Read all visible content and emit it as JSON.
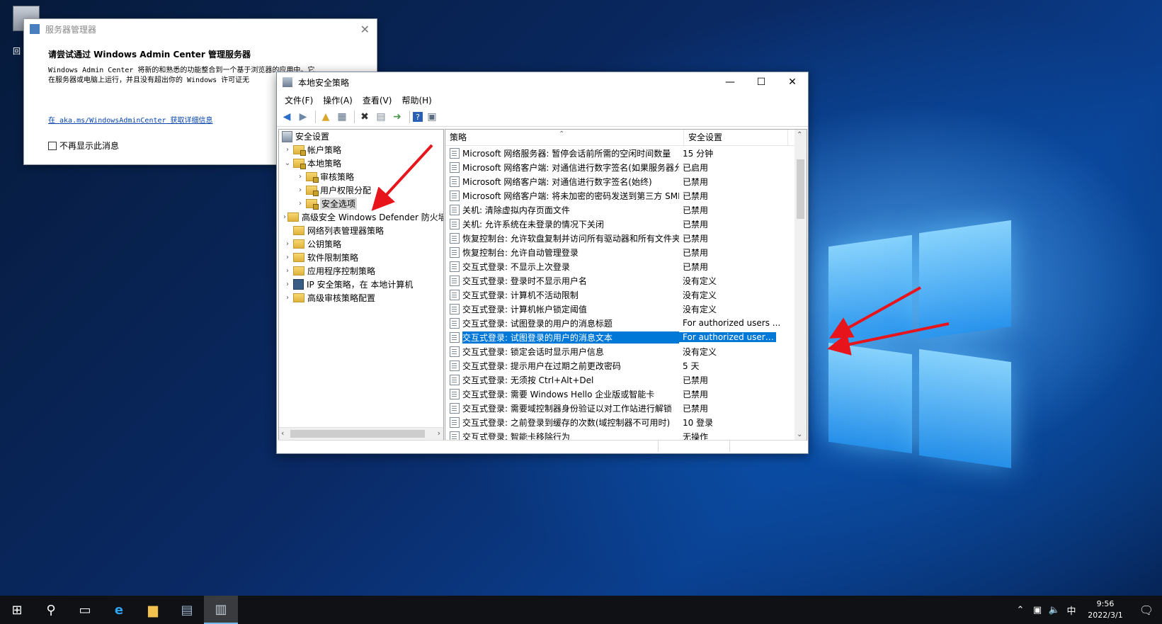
{
  "desktop": {
    "icon_label": "回"
  },
  "server_manager": {
    "title": "服务器管理器",
    "heading": "请尝试通过 Windows Admin Center 管理服务器",
    "body_line1": "Windows Admin Center 将新的和熟悉的功能整合到一个基于浏览器的应用中。它",
    "body_line2": "在服务器或电脑上运行，并且没有超出你的 Windows 许可证无",
    "link": "在 aka.ms/WindowsAdminCenter 获取详细信息",
    "checkbox_label": "不再显示此消息"
  },
  "window": {
    "title": "本地安全策略",
    "menu": [
      "文件(F)",
      "操作(A)",
      "查看(V)",
      "帮助(H)"
    ]
  },
  "tree": {
    "root": "安全设置",
    "items": [
      {
        "label": "帐户策略",
        "level": 1,
        "expander": "›",
        "icon": "lock-folder"
      },
      {
        "label": "本地策略",
        "level": 1,
        "expander": "⌄",
        "icon": "lock-folder"
      },
      {
        "label": "审核策略",
        "level": 2,
        "expander": "›",
        "icon": "lock-folder"
      },
      {
        "label": "用户权限分配",
        "level": 2,
        "expander": "›",
        "icon": "lock-folder"
      },
      {
        "label": "安全选项",
        "level": 2,
        "expander": "›",
        "icon": "lock-folder",
        "selected": true
      },
      {
        "label": "高级安全 Windows Defender 防火墙",
        "level": 1,
        "expander": "›",
        "icon": "folder"
      },
      {
        "label": "网络列表管理器策略",
        "level": 1,
        "expander": "",
        "icon": "folder"
      },
      {
        "label": "公钥策略",
        "level": 1,
        "expander": "›",
        "icon": "folder"
      },
      {
        "label": "软件限制策略",
        "level": 1,
        "expander": "›",
        "icon": "folder"
      },
      {
        "label": "应用程序控制策略",
        "level": 1,
        "expander": "›",
        "icon": "folder"
      },
      {
        "label": "IP 安全策略，在 本地计算机",
        "level": 1,
        "expander": "›",
        "icon": "ip-policy"
      },
      {
        "label": "高级审核策略配置",
        "level": 1,
        "expander": "›",
        "icon": "folder"
      }
    ]
  },
  "list": {
    "col_policy": "策略",
    "col_setting": "安全设置",
    "rows": [
      {
        "policy": "Microsoft 网络服务器: 暂停会话前所需的空闲时间数量",
        "setting": "15 分钟"
      },
      {
        "policy": "Microsoft 网络客户端: 对通信进行数字签名(如果服务器允...",
        "setting": "已启用"
      },
      {
        "policy": "Microsoft 网络客户端: 对通信进行数字签名(始终)",
        "setting": "已禁用"
      },
      {
        "policy": "Microsoft 网络客户端: 将未加密的密码发送到第三方 SMB...",
        "setting": "已禁用"
      },
      {
        "policy": "关机: 清除虚拟内存页面文件",
        "setting": "已禁用"
      },
      {
        "policy": "关机: 允许系统在未登录的情况下关闭",
        "setting": "已禁用"
      },
      {
        "policy": "恢复控制台: 允许软盘复制并访问所有驱动器和所有文件夹",
        "setting": "已禁用"
      },
      {
        "policy": "恢复控制台: 允许自动管理登录",
        "setting": "已禁用"
      },
      {
        "policy": "交互式登录: 不显示上次登录",
        "setting": "已禁用"
      },
      {
        "policy": "交互式登录: 登录时不显示用户名",
        "setting": "没有定义"
      },
      {
        "policy": "交互式登录: 计算机不活动限制",
        "setting": "没有定义"
      },
      {
        "policy": "交互式登录: 计算机帐户锁定阈值",
        "setting": "没有定义"
      },
      {
        "policy": "交互式登录: 试图登录的用户的消息标题",
        "setting": "For authorized users ..."
      },
      {
        "policy": "交互式登录: 试图登录的用户的消息文本",
        "setting": "For authorized users ...",
        "selected": true
      },
      {
        "policy": "交互式登录: 锁定会话时显示用户信息",
        "setting": "没有定义"
      },
      {
        "policy": "交互式登录: 提示用户在过期之前更改密码",
        "setting": "5 天"
      },
      {
        "policy": "交互式登录: 无须按 Ctrl+Alt+Del",
        "setting": "已禁用"
      },
      {
        "policy": "交互式登录: 需要 Windows Hello 企业版或智能卡",
        "setting": "已禁用"
      },
      {
        "policy": "交互式登录: 需要域控制器身份验证以对工作站进行解锁",
        "setting": "已禁用"
      },
      {
        "policy": "交互式登录: 之前登录到缓存的次数(域控制器不可用时)",
        "setting": "10 登录"
      },
      {
        "policy": "交互式登录: 智能卡移除行为",
        "setting": "无操作"
      }
    ]
  },
  "taskbar": {
    "ime": "中",
    "time": "9:56",
    "date": "2022/3/1"
  }
}
